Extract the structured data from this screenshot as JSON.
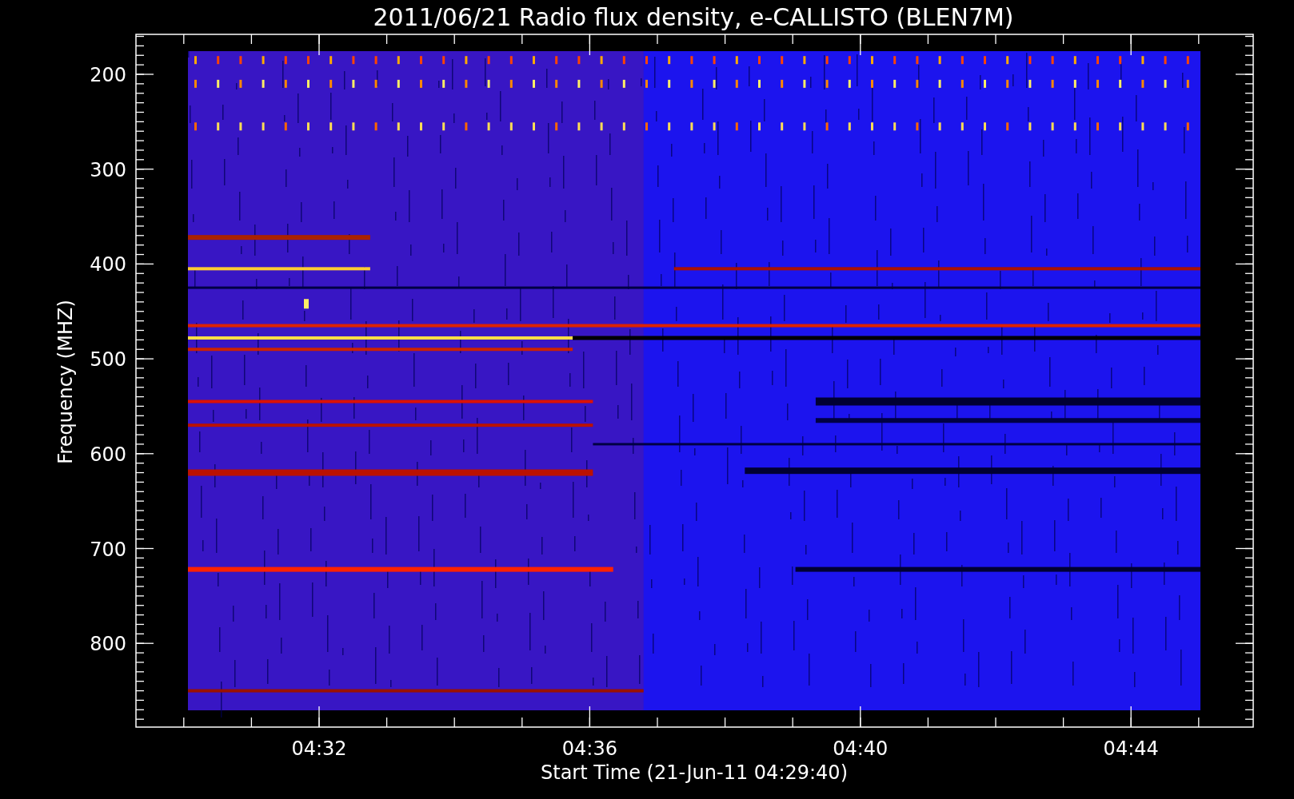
{
  "chart": {
    "title": "2011/06/21  Radio flux density, e-CALLISTO (BLEN7M)",
    "ylabel": "Frequency (MHZ)",
    "xlabel": "Start Time (21-Jun-11 04:29:40)",
    "yticks": [
      "200",
      "300",
      "400",
      "500",
      "600",
      "700",
      "800"
    ],
    "xticks": [
      "04:32",
      "04:36",
      "04:40",
      "04:44"
    ]
  }
}
